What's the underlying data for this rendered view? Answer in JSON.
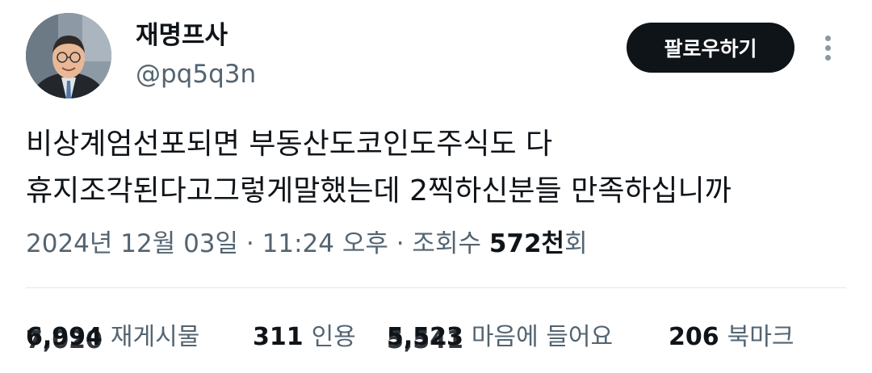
{
  "author": {
    "display_name": "재명프사",
    "handle": "@pq5q3n"
  },
  "follow_button": "팔로우하기",
  "tweet": {
    "lines": [
      "비상계엄선포되면 부동산도코인도주식도 다",
      "휴지조각된다고그렇게말했는데 2찍하신분들 만족하십니까"
    ]
  },
  "meta": {
    "date": "2024년 12월 03일",
    "sep1": " · ",
    "time": "11:24 오후",
    "sep2": " · ",
    "views_label": "조회수 ",
    "views_count": "572천",
    "views_suffix": "회"
  },
  "stats": {
    "retweets_count": "6,994",
    "retweets_count_ghost": "7,020",
    "retweets_label": "재게시물",
    "quotes_count": "311",
    "quotes_label": "인용",
    "likes_count": "5,523",
    "likes_count_ghost": "5,541",
    "likes_label": "마음에 들어요",
    "bookmarks_count": "206",
    "bookmarks_label": "북마크"
  }
}
